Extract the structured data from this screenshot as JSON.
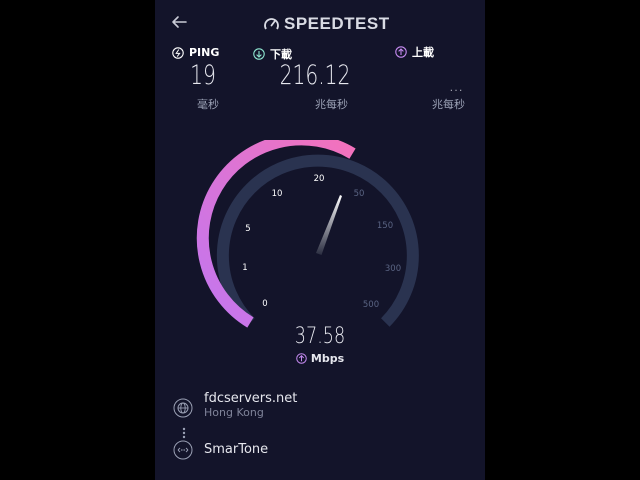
{
  "header": {
    "logo_text": "SPEEDTEST"
  },
  "metrics": {
    "ping": {
      "label": "PING",
      "value": "19",
      "unit": "毫秒"
    },
    "download": {
      "label": "下載",
      "value": "216.12",
      "unit": "兆每秒"
    },
    "upload": {
      "label": "上載",
      "value": "...",
      "unit": "兆每秒"
    }
  },
  "gauge": {
    "ticks": [
      "0",
      "1",
      "5",
      "10",
      "20",
      "50",
      "150",
      "300",
      "500"
    ],
    "current_speed": "37.58",
    "unit": "Mbps"
  },
  "server": {
    "name": "fdcservers.net",
    "location": "Hong Kong"
  },
  "provider": {
    "name": "SmarTone"
  },
  "colors": {
    "background": "#13142a",
    "gauge_active": "#f06fc7",
    "gauge_track": "#2a3350",
    "download_icon": "#8ee6d0",
    "upload_icon": "#c58af0"
  }
}
